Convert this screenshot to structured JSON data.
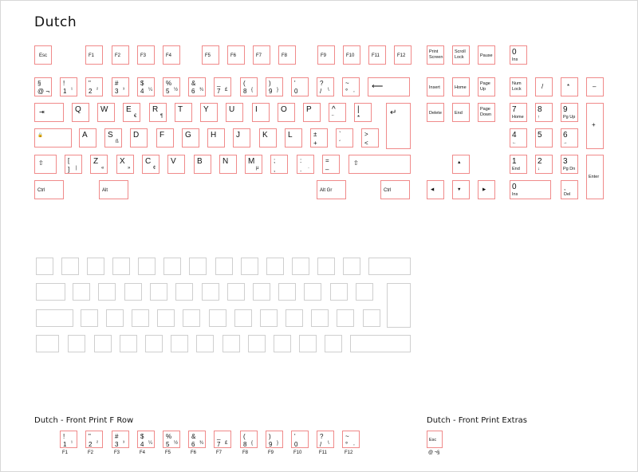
{
  "title": "Dutch",
  "front_fn_title": "Dutch - Front Print F Row",
  "front_extras_title": "Dutch - Front Print Extras",
  "keys": {
    "esc": "Esc",
    "f1": "F1",
    "f2": "F2",
    "f3": "F3",
    "f4": "F4",
    "f5": "F5",
    "f6": "F6",
    "f7": "F7",
    "f8": "F8",
    "f9": "F9",
    "f10": "F10",
    "f11": "F11",
    "f12": "F12",
    "prtsc": "Print\nScreen",
    "scroll": "Scroll\nLock",
    "pause": "Pause",
    "insert": "Insert",
    "home": "Home",
    "pgup": "Page\nUp",
    "delete": "Delete",
    "end": "End",
    "pgdn": "Page\nDown",
    "numlock": "Num\nLock",
    "ctrl": "Ctrl",
    "alt": "Alt",
    "altgr": "Alt Gr",
    "enter": "Enter",
    "ins": "Ins",
    "del": "Del",
    "np_home": "Home",
    "np_pgup": "Pg Up",
    "np_end": "End",
    "np_pgdn": "Pg Dn"
  },
  "legends": {
    "num_row": [
      {
        "tl": "§",
        "bl": "@ ¬"
      },
      {
        "tl": "!",
        "bl": "1",
        "br": "¹"
      },
      {
        "tl": "\"",
        "bl": "2",
        "br": "²"
      },
      {
        "tl": "#",
        "bl": "3",
        "br": "³"
      },
      {
        "tl": "$",
        "bl": "4",
        "br": "¼"
      },
      {
        "tl": "%",
        "bl": "5",
        "br": "½"
      },
      {
        "tl": "&",
        "bl": "6",
        "br": "¾"
      },
      {
        "tl": "_",
        "bl": "7",
        "br": "£"
      },
      {
        "tl": "(",
        "bl": "8",
        "br": "{"
      },
      {
        "tl": ")",
        "bl": "9",
        "br": "}"
      },
      {
        "tl": "'",
        "bl": "0"
      },
      {
        "tl": "?",
        "bl": "/",
        "br": "\\"
      },
      {
        "tl": "~",
        "bl": "°",
        "br": "¸"
      }
    ],
    "q_row": [
      {
        "tl": "Q"
      },
      {
        "tl": "W"
      },
      {
        "tl": "E",
        "br": "€"
      },
      {
        "tl": "R",
        "br": "¶"
      },
      {
        "tl": "T"
      },
      {
        "tl": "Y"
      },
      {
        "tl": "U"
      },
      {
        "tl": "I"
      },
      {
        "tl": "O"
      },
      {
        "tl": "P"
      },
      {
        "tl": "^",
        "bl": "¨"
      },
      {
        "tl": "|",
        "bl": "*"
      }
    ],
    "a_row": [
      {
        "tl": "A"
      },
      {
        "tl": "S",
        "br": "ß"
      },
      {
        "tl": "D"
      },
      {
        "tl": "F"
      },
      {
        "tl": "G"
      },
      {
        "tl": "H"
      },
      {
        "tl": "J"
      },
      {
        "tl": "K"
      },
      {
        "tl": "L"
      },
      {
        "tl": "±",
        "bl": "+"
      },
      {
        "tl": "`",
        "bl": "´"
      },
      {
        "tl": ">",
        "bl": "<"
      }
    ],
    "z_row": [
      {
        "tl": "[",
        "bl": "]",
        "br": "|"
      },
      {
        "tl": "Z",
        "br": "«"
      },
      {
        "tl": "X",
        "br": "»"
      },
      {
        "tl": "C",
        "br": "¢"
      },
      {
        "tl": "V"
      },
      {
        "tl": "B"
      },
      {
        "tl": "N"
      },
      {
        "tl": "M",
        "br": "µ"
      },
      {
        "tl": ";",
        "bl": ","
      },
      {
        "tl": ":",
        "bl": ".",
        "br": "·"
      },
      {
        "tl": "=",
        "bl": "–"
      }
    ],
    "numpad": {
      "slash": "/",
      "star": "*",
      "minus": "–",
      "plus": "+",
      "n7": "7",
      "n8": "8",
      "n9": "9",
      "n4": "4",
      "n5": "5",
      "n6": "6",
      "n1": "1",
      "n2": "2",
      "n3": "3",
      "n0": "0",
      "dot": ",",
      "a8": "↑",
      "a4": "←",
      "a6": "→",
      "a2": "↓"
    },
    "icons": {
      "tab": "⇥",
      "caps": "🔒",
      "shift": "⇧",
      "backspace": "⟵",
      "enter": "↵",
      "up": "▲",
      "left": "◀",
      "down": "▼",
      "right": "▶"
    }
  }
}
